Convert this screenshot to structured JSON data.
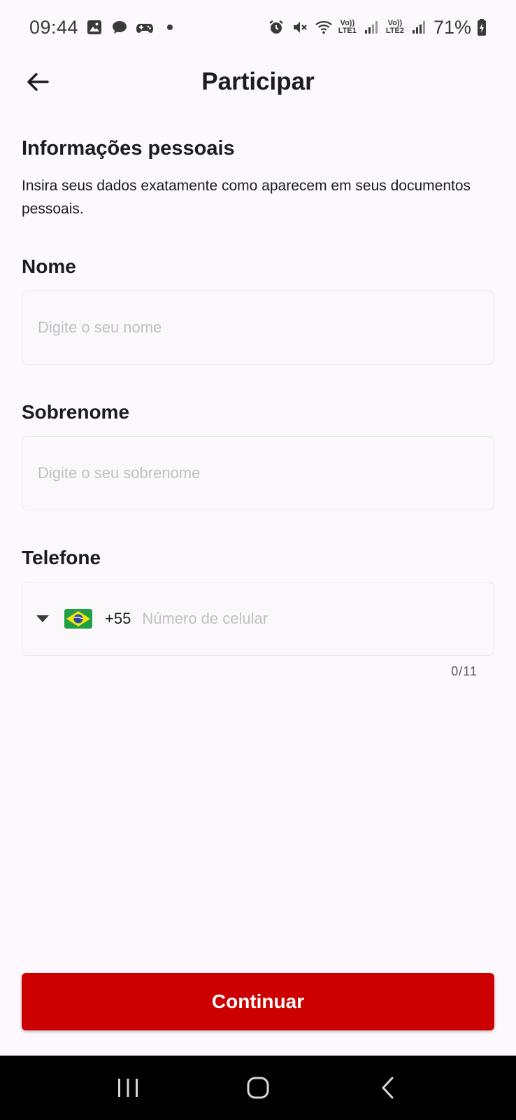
{
  "status_bar": {
    "time": "09:44",
    "battery_percent": "71%",
    "sim1_label_top": "Vo))",
    "sim1_label_bottom": "LTE1",
    "sim2_label_top": "Vo))",
    "sim2_label_bottom": "LTE2",
    "left_icons": [
      "image-icon",
      "chat-bubble-icon",
      "game-controller-icon",
      "dot-icon"
    ],
    "right_icons": [
      "alarm-icon",
      "mute-icon",
      "wifi-icon",
      "signal-icon",
      "signal-icon",
      "battery-icon"
    ]
  },
  "app_bar": {
    "title": "Participar",
    "back_icon": "arrow-left-icon"
  },
  "form": {
    "section_title": "Informações pessoais",
    "section_description": "Insira seus dados exatamente como aparecem em seus documentos pessoais.",
    "first_name": {
      "label": "Nome",
      "placeholder": "Digite o seu nome",
      "value": ""
    },
    "last_name": {
      "label": "Sobrenome",
      "placeholder": "Digite o seu sobrenome",
      "value": ""
    },
    "phone": {
      "label": "Telefone",
      "country_flag": "brazil-flag-icon",
      "country_code": "+55",
      "placeholder": "Número de celular",
      "value": "",
      "counter": "0/11"
    }
  },
  "actions": {
    "continue_label": "Continuar",
    "button_color": "#cc0000"
  },
  "nav_bar": {
    "icons": [
      "recent-apps-icon",
      "home-icon",
      "back-icon"
    ]
  }
}
